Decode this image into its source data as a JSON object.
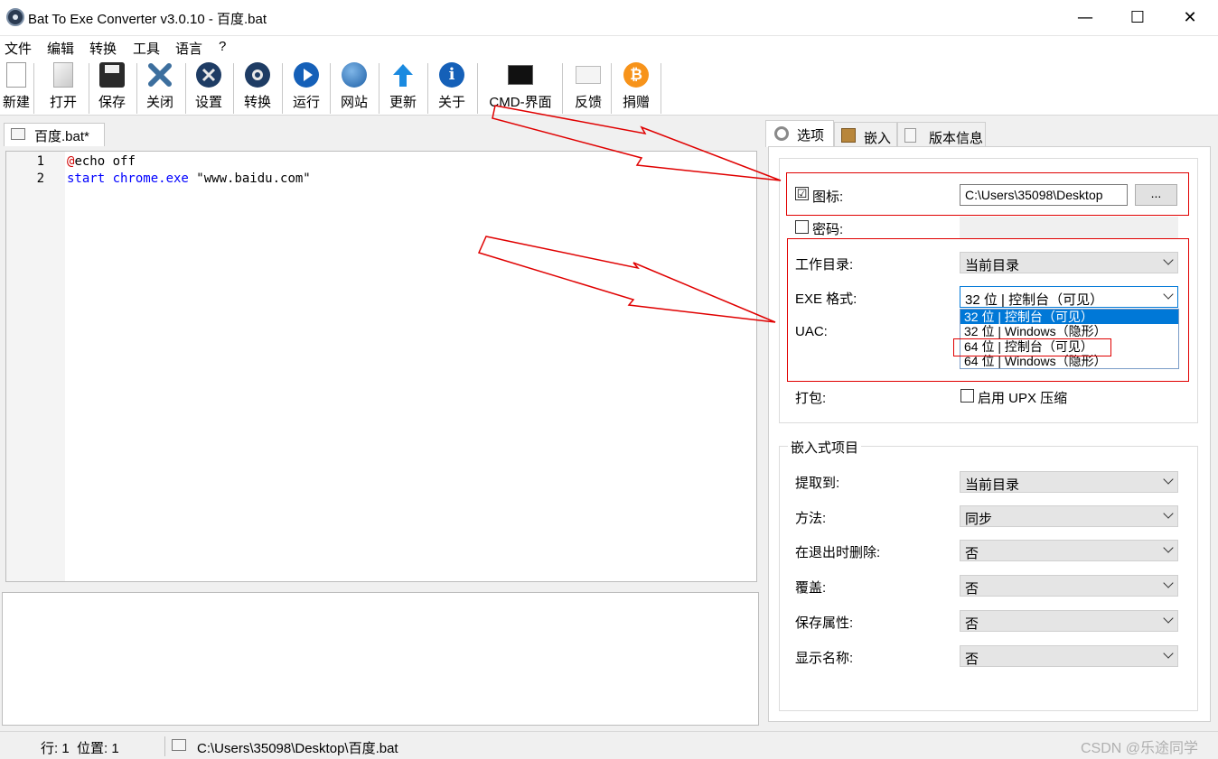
{
  "window": {
    "title": "Bat To Exe Converter v3.0.10 - 百度.bat",
    "minimize": "—",
    "maximize": "☐",
    "close": "✕"
  },
  "menu": [
    "文件",
    "编辑",
    "转换",
    "工具",
    "语言",
    "?"
  ],
  "toolbar": [
    {
      "label": "新建",
      "icon": "new-file-icon"
    },
    {
      "label": "打开",
      "icon": "open-file-icon"
    },
    {
      "label": "保存",
      "icon": "save-icon"
    },
    {
      "label": "关闭",
      "icon": "close-file-icon"
    },
    {
      "label": "设置",
      "icon": "tools-icon"
    },
    {
      "label": "转换",
      "icon": "gear-icon"
    },
    {
      "label": "运行",
      "icon": "run-icon"
    },
    {
      "label": "网站",
      "icon": "globe-icon"
    },
    {
      "label": "更新",
      "icon": "update-arrow-icon"
    },
    {
      "label": "关于",
      "icon": "info-icon"
    },
    {
      "label": "CMD-界面",
      "icon": "cmd-icon"
    },
    {
      "label": "反馈",
      "icon": "mail-icon"
    },
    {
      "label": "捐赠",
      "icon": "bitcoin-icon"
    }
  ],
  "editor": {
    "tab_label": "百度.bat*",
    "lines": [
      {
        "num": "1",
        "parts": [
          {
            "text": "@",
            "color": "#d00000"
          },
          {
            "text": "echo off",
            "color": "#000000"
          }
        ]
      },
      {
        "num": "2",
        "parts": [
          {
            "text": "start ",
            "color": "#0000ff"
          },
          {
            "text": "chrome.exe ",
            "color": "#0000ff"
          },
          {
            "text": "\"www.baidu.com\"",
            "color": "#000000"
          }
        ]
      }
    ]
  },
  "right_tabs": [
    {
      "label": "选项",
      "icon": "gear-tab-icon"
    },
    {
      "label": "嵌入",
      "icon": "box-tab-icon"
    },
    {
      "label": "版本信息",
      "icon": "document-tab-icon"
    }
  ],
  "options": {
    "icon_checkbox": {
      "label": "图标:",
      "checked": "☑",
      "path": "C:\\Users\\35098\\Desktop",
      "browse": "..."
    },
    "password_checkbox": {
      "label": "密码:"
    },
    "workdir": {
      "label": "工作目录:",
      "value": "当前目录"
    },
    "exe_format": {
      "label": "EXE 格式:",
      "value": "32 位 | 控制台（可见）",
      "options": [
        "32 位 | 控制台（可见）",
        "32 位 | Windows（隐形）",
        "64 位 | 控制台（可见）",
        "64 位 | Windows（隐形）"
      ]
    },
    "uac": {
      "label": "UAC:"
    },
    "pack": {
      "label": "打包:",
      "checkbox_label": "启用 UPX 压缩"
    }
  },
  "embedded": {
    "title": "嵌入式项目",
    "rows": [
      {
        "label": "提取到:",
        "value": "当前目录"
      },
      {
        "label": "方法:",
        "value": "同步"
      },
      {
        "label": "在退出时删除:",
        "value": "否"
      },
      {
        "label": "覆盖:",
        "value": "否"
      },
      {
        "label": "保存属性:",
        "value": "否"
      },
      {
        "label": "显示名称:",
        "value": "否"
      }
    ]
  },
  "status": {
    "position": "行: 1  位置: 1",
    "path": "C:\\Users\\35098\\Desktop\\百度.bat"
  },
  "watermark": "CSDN @乐途同学",
  "colors": {
    "accent": "#0078d7",
    "annotation_red": "#e00000"
  }
}
